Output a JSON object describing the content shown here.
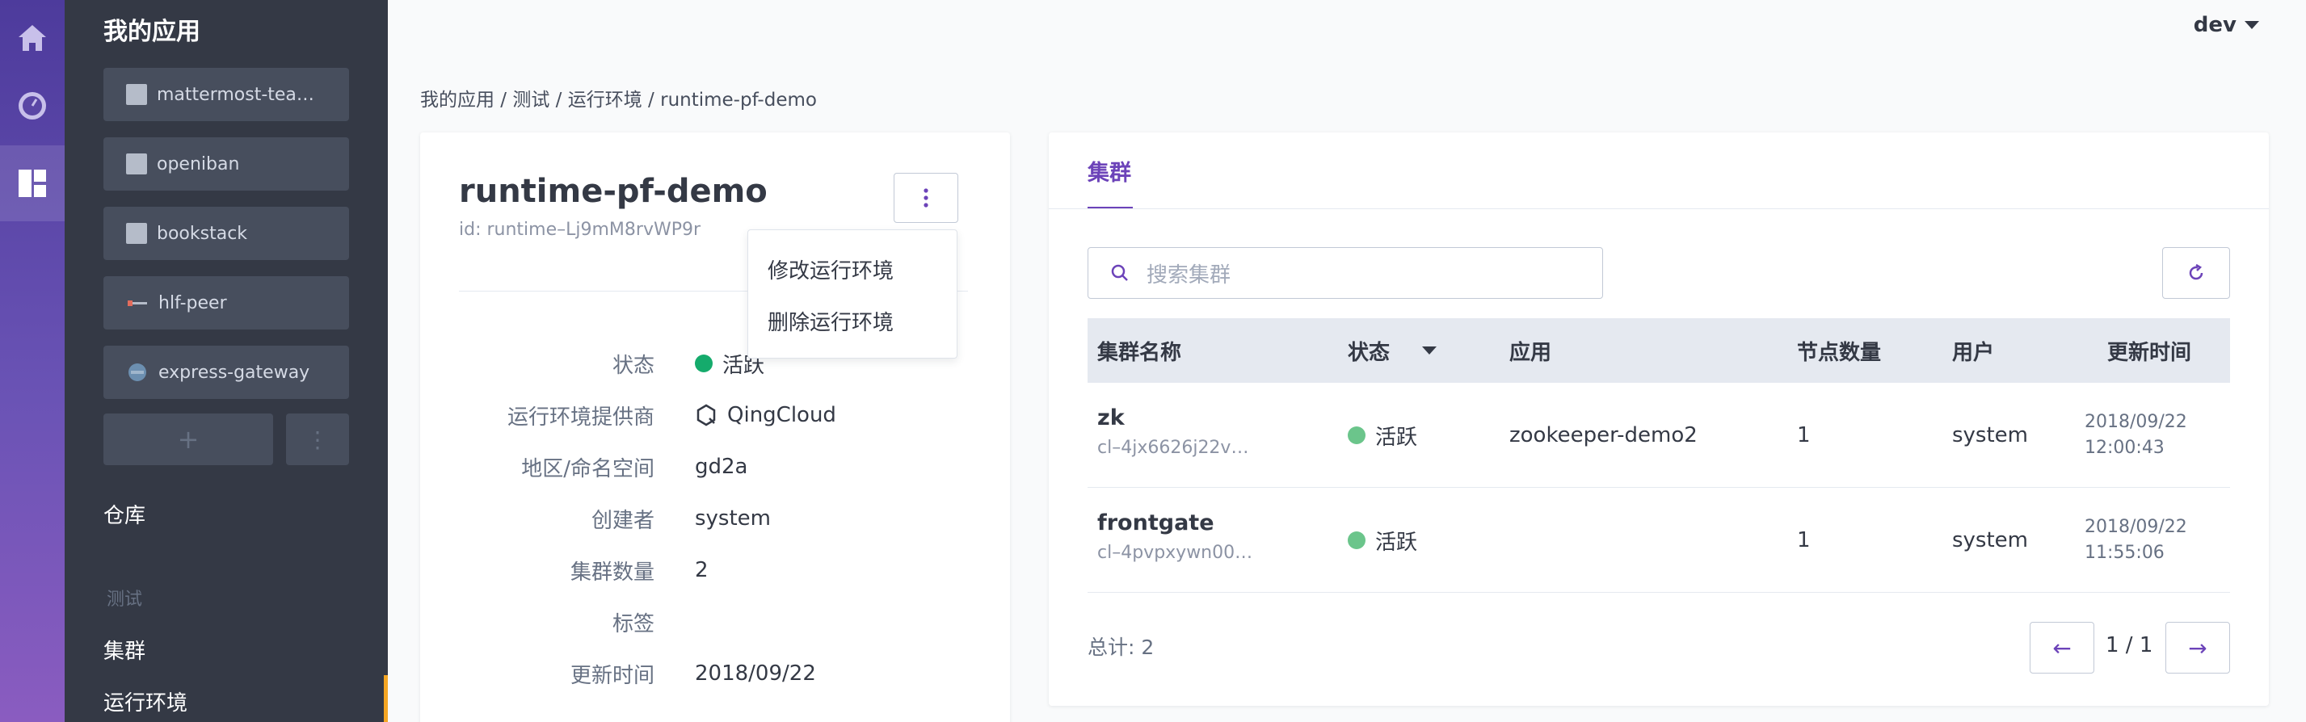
{
  "user": {
    "name": "dev"
  },
  "sidebar": {
    "title": "我的应用",
    "apps": [
      {
        "label": "mattermost-team…",
        "icon": "square-icon"
      },
      {
        "label": "openiban",
        "icon": "square-icon"
      },
      {
        "label": "bookstack",
        "icon": "square-icon"
      },
      {
        "label": "hlf-peer",
        "icon": "hyperledger-icon"
      },
      {
        "label": "express-gateway",
        "icon": "gateway-icon"
      }
    ],
    "add_label": "+",
    "more_label": "⋮",
    "repo_label": "仓库",
    "group_label": "测试",
    "cluster_label": "集群",
    "runtime_label": "运行环境"
  },
  "breadcrumb": "我的应用 / 测试 / 运行环境 / runtime-pf-demo",
  "runtime": {
    "name": "runtime-pf-demo",
    "id": "id: runtime–Lj9mM8rvWP9r",
    "fields": [
      {
        "key": "状态",
        "value": "活跃"
      },
      {
        "key": "运行环境提供商",
        "value": "QingCloud"
      },
      {
        "key": "地区/命名空间",
        "value": "gd2a"
      },
      {
        "key": "创建者",
        "value": "system"
      },
      {
        "key": "集群数量",
        "value": "2"
      },
      {
        "key": "标签",
        "value": ""
      },
      {
        "key": "更新时间",
        "value": "2018/09/22"
      }
    ]
  },
  "dropdown": {
    "items": [
      "修改运行环境",
      "删除运行环境"
    ]
  },
  "clusters": {
    "tab_label": "集群",
    "search_placeholder": "搜索集群",
    "columns": [
      "集群名称",
      "状态",
      "应用",
      "节点数量",
      "用户",
      "更新时间"
    ],
    "rows": [
      {
        "name": "zk",
        "id": "cl–4jx6626j22v…",
        "status": "活跃",
        "app": "zookeeper-demo2",
        "nodes": "1",
        "user": "system",
        "date": "2018/09/22",
        "time": "12:00:43"
      },
      {
        "name": "frontgate",
        "id": "cl–4pvpxywn00…",
        "status": "活跃",
        "app": "",
        "nodes": "1",
        "user": "system",
        "date": "2018/09/22",
        "time": "11:55:06"
      }
    ],
    "total": "总计: 2",
    "page": "1 / 1",
    "prev_label": "←",
    "next_label": "→"
  },
  "colors": {
    "accent": "#6c43b9",
    "active_green": "#15ab6c",
    "sidebar_bg": "#343945"
  }
}
